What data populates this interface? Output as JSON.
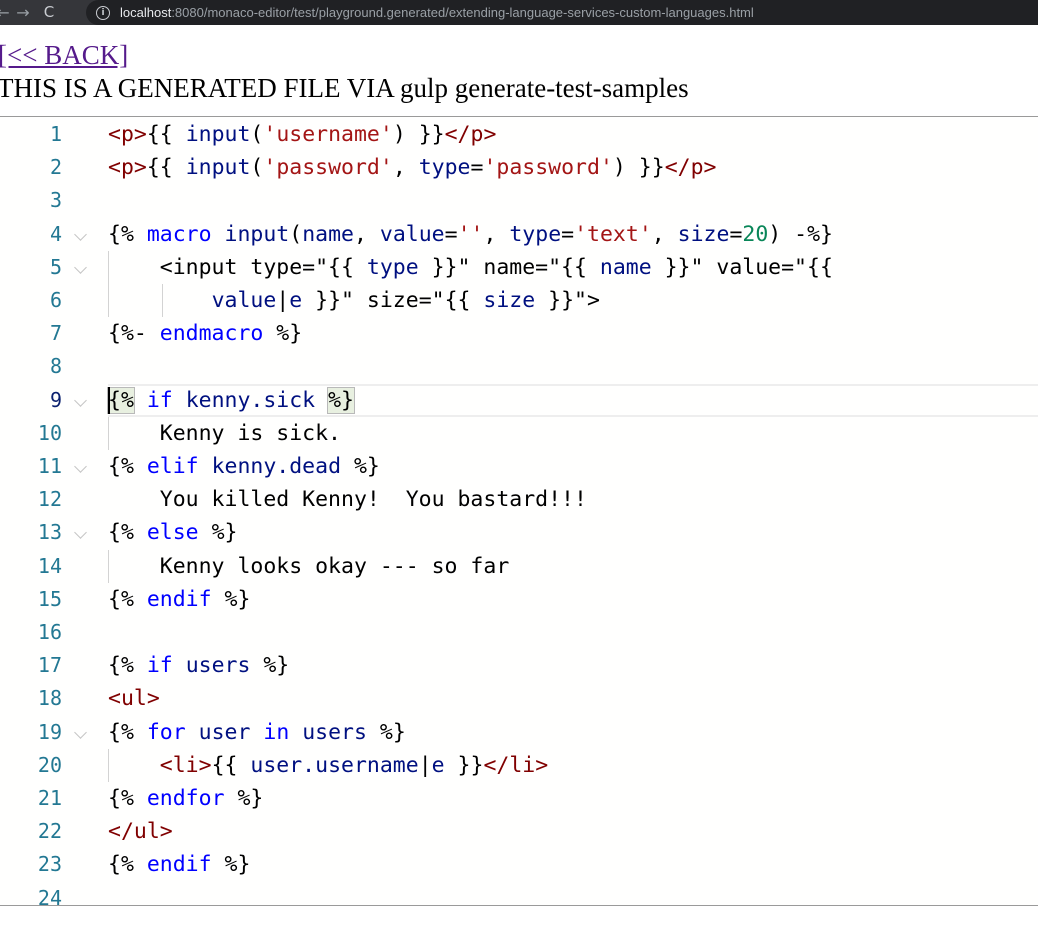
{
  "browser": {
    "url_host": "localhost",
    "url_path": ":8080/monaco-editor/test/playground.generated/extending-language-services-custom-languages.html",
    "back_glyph": "←",
    "forward_glyph": "→",
    "reload_glyph": "C",
    "info_glyph": "i"
  },
  "page": {
    "back_link": "[<< BACK]",
    "generated_note": "THIS IS A GENERATED FILE VIA gulp generate-test-samples"
  },
  "editor": {
    "lines": [
      {
        "n": "1",
        "tokens": [
          [
            "tag",
            "<p>"
          ],
          [
            "ctrl",
            "{{ "
          ],
          [
            "id",
            "input"
          ],
          [
            "ctrl",
            "("
          ],
          [
            "str",
            "'username'"
          ],
          [
            "ctrl",
            ") }}"
          ],
          [
            "tag",
            "</p>"
          ]
        ]
      },
      {
        "n": "2",
        "tokens": [
          [
            "tag",
            "<p>"
          ],
          [
            "ctrl",
            "{{ "
          ],
          [
            "id",
            "input"
          ],
          [
            "ctrl",
            "("
          ],
          [
            "str",
            "'password'"
          ],
          [
            "ctrl",
            ", "
          ],
          [
            "id",
            "type"
          ],
          [
            "ctrl",
            "="
          ],
          [
            "str",
            "'password'"
          ],
          [
            "ctrl",
            ") }}"
          ],
          [
            "tag",
            "</p>"
          ]
        ]
      },
      {
        "n": "3",
        "tokens": []
      },
      {
        "n": "4",
        "tokens": [
          [
            "ctrl",
            "{% "
          ],
          [
            "kw",
            "macro"
          ],
          [
            "ctrl",
            " "
          ],
          [
            "id",
            "input"
          ],
          [
            "ctrl",
            "("
          ],
          [
            "id",
            "name"
          ],
          [
            "ctrl",
            ", "
          ],
          [
            "id",
            "value"
          ],
          [
            "ctrl",
            "="
          ],
          [
            "str",
            "''"
          ],
          [
            "ctrl",
            ", "
          ],
          [
            "id",
            "type"
          ],
          [
            "ctrl",
            "="
          ],
          [
            "str",
            "'text'"
          ],
          [
            "ctrl",
            ", "
          ],
          [
            "id",
            "size"
          ],
          [
            "ctrl",
            "="
          ],
          [
            "num",
            "20"
          ],
          [
            "ctrl",
            ") -%}"
          ]
        ]
      },
      {
        "n": "5",
        "tokens": [
          [
            "ctrl",
            "    <input type=\"{{ "
          ],
          [
            "id",
            "type"
          ],
          [
            "ctrl",
            " }}\" name=\"{{ "
          ],
          [
            "id",
            "name"
          ],
          [
            "ctrl",
            " }}\" value=\"{{"
          ]
        ]
      },
      {
        "n": "6",
        "tokens": [
          [
            "ctrl",
            "        "
          ],
          [
            "id",
            "value"
          ],
          [
            "ctrl",
            "|"
          ],
          [
            "id",
            "e"
          ],
          [
            "ctrl",
            " }}\" size=\"{{ "
          ],
          [
            "id",
            "size"
          ],
          [
            "ctrl",
            " }}\">"
          ]
        ]
      },
      {
        "n": "7",
        "tokens": [
          [
            "ctrl",
            "{%- "
          ],
          [
            "kw",
            "endmacro"
          ],
          [
            "ctrl",
            " %}"
          ]
        ]
      },
      {
        "n": "8",
        "tokens": []
      },
      {
        "n": "9",
        "tokens": [
          [
            "ctrl",
            "{% "
          ],
          [
            "kw",
            "if"
          ],
          [
            "ctrl",
            " "
          ],
          [
            "id",
            "kenny.sick"
          ],
          [
            "ctrl",
            " %}"
          ]
        ]
      },
      {
        "n": "10",
        "tokens": [
          [
            "ctrl",
            "    Kenny is sick."
          ]
        ]
      },
      {
        "n": "11",
        "tokens": [
          [
            "ctrl",
            "{% "
          ],
          [
            "kw",
            "elif"
          ],
          [
            "ctrl",
            " "
          ],
          [
            "id",
            "kenny.dead"
          ],
          [
            "ctrl",
            " %}"
          ]
        ]
      },
      {
        "n": "12",
        "tokens": [
          [
            "ctrl",
            "    You killed Kenny!  You bastard!!!"
          ]
        ]
      },
      {
        "n": "13",
        "tokens": [
          [
            "ctrl",
            "{% "
          ],
          [
            "kw",
            "else"
          ],
          [
            "ctrl",
            " %}"
          ]
        ]
      },
      {
        "n": "14",
        "tokens": [
          [
            "ctrl",
            "    Kenny looks okay --- so far"
          ]
        ]
      },
      {
        "n": "15",
        "tokens": [
          [
            "ctrl",
            "{% "
          ],
          [
            "kw",
            "endif"
          ],
          [
            "ctrl",
            " %}"
          ]
        ]
      },
      {
        "n": "16",
        "tokens": []
      },
      {
        "n": "17",
        "tokens": [
          [
            "ctrl",
            "{% "
          ],
          [
            "kw",
            "if"
          ],
          [
            "ctrl",
            " "
          ],
          [
            "id",
            "users"
          ],
          [
            "ctrl",
            " %}"
          ]
        ]
      },
      {
        "n": "18",
        "tokens": [
          [
            "tag",
            "<ul>"
          ]
        ]
      },
      {
        "n": "19",
        "tokens": [
          [
            "ctrl",
            "{% "
          ],
          [
            "kw",
            "for"
          ],
          [
            "ctrl",
            " "
          ],
          [
            "id",
            "user"
          ],
          [
            "ctrl",
            " "
          ],
          [
            "kw",
            "in"
          ],
          [
            "ctrl",
            " "
          ],
          [
            "id",
            "users"
          ],
          [
            "ctrl",
            " %}"
          ]
        ]
      },
      {
        "n": "20",
        "tokens": [
          [
            "ctrl",
            "    "
          ],
          [
            "tag",
            "<li>"
          ],
          [
            "ctrl",
            "{{ "
          ],
          [
            "id",
            "user.username"
          ],
          [
            "ctrl",
            "|"
          ],
          [
            "id",
            "e"
          ],
          [
            "ctrl",
            " }}"
          ],
          [
            "tag",
            "</li>"
          ]
        ]
      },
      {
        "n": "21",
        "tokens": [
          [
            "ctrl",
            "{% "
          ],
          [
            "kw",
            "endfor"
          ],
          [
            "ctrl",
            " %}"
          ]
        ]
      },
      {
        "n": "22",
        "tokens": [
          [
            "tag",
            "</ul>"
          ]
        ]
      },
      {
        "n": "23",
        "tokens": [
          [
            "ctrl",
            "{% "
          ],
          [
            "kw",
            "endif"
          ],
          [
            "ctrl",
            " %}"
          ]
        ]
      },
      {
        "n": "24",
        "tokens": []
      }
    ],
    "active_line": "9",
    "foldable_lines": [
      "4",
      "5",
      "9",
      "11",
      "13",
      "19"
    ],
    "indent_guides": {
      "5": [
        1
      ],
      "6": [
        1,
        2
      ],
      "10": [
        1
      ],
      "14": [
        1
      ],
      "20": [
        1
      ]
    },
    "colors": {
      "line_number": "#237893",
      "keyword": "#0000ff",
      "identifier": "#001080",
      "string": "#a31515",
      "number": "#098658",
      "tag": "#800000"
    }
  }
}
